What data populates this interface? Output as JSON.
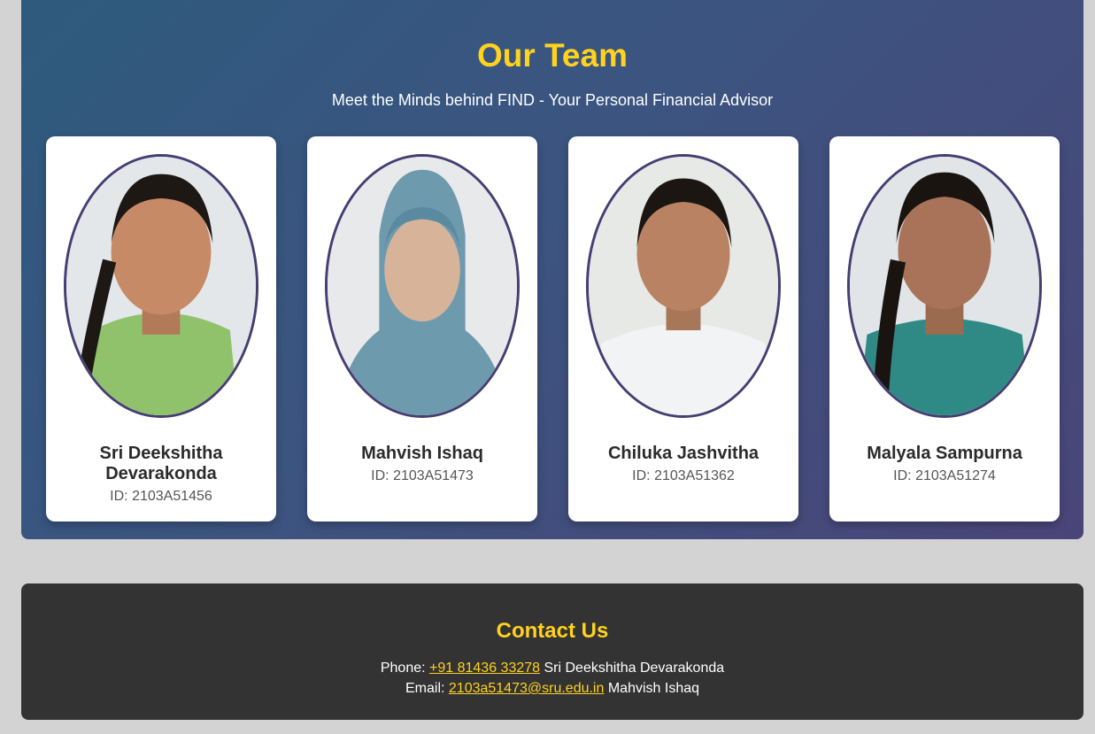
{
  "team": {
    "title": "Our Team",
    "subtitle": "Meet the Minds behind FIND - Your Personal Financial Advisor",
    "members": [
      {
        "name": "Sri Deekshitha Devarakonda",
        "id": "ID: 2103A51456"
      },
      {
        "name": "Mahvish Ishaq",
        "id": "ID: 2103A51473"
      },
      {
        "name": "Chiluka Jashvitha",
        "id": "ID: 2103A51362"
      },
      {
        "name": "Malyala Sampurna",
        "id": "ID: 2103A51274"
      }
    ]
  },
  "contact": {
    "title": "Contact Us",
    "phone_label": "Phone:",
    "phone_value": "+91 81436 33278",
    "phone_person": "Sri Deekshitha Devarakonda",
    "email_label": "Email:",
    "email_value": "2103a51473@sru.edu.in",
    "email_person": "Mahvish Ishaq"
  },
  "colors": {
    "accent": "#ffd21f",
    "team_gradient_start": "#2e5a7e",
    "team_gradient_end": "#4a4579",
    "photo_border": "#463d72",
    "contact_bg": "#333333",
    "page_bg": "#d3d3d3"
  }
}
